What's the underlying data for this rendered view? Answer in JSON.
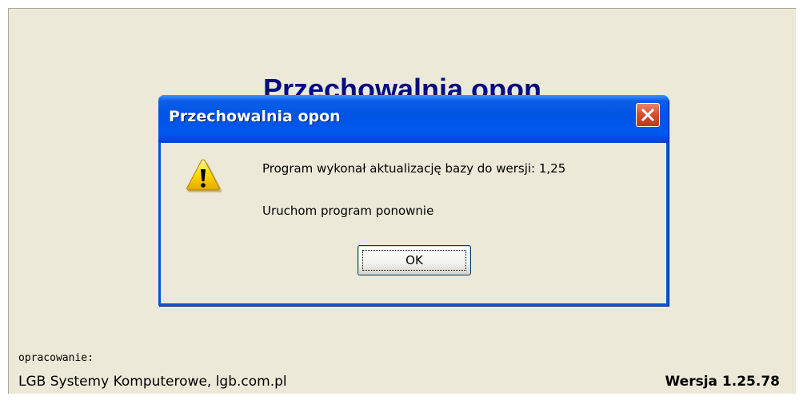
{
  "splash": {
    "title": "Przechowalnia opon",
    "credits_label": "opracowanie:",
    "credits_company": "LGB Systemy Komputerowe, lgb.com.pl",
    "version": "Wersja 1.25.78"
  },
  "dialog": {
    "title": "Przechowalnia opon",
    "icon": "warning-icon",
    "message_line1": "Program wykonał aktualizację bazy do wersji: 1,25",
    "message_line2": "Uruchom program ponownie",
    "ok_label": "OK",
    "close_icon": "close-icon"
  },
  "colors": {
    "titlebar": "#0054e3",
    "close_button": "#d54c29",
    "background_title": "#0a0a80",
    "window_face": "#ece9d8"
  }
}
